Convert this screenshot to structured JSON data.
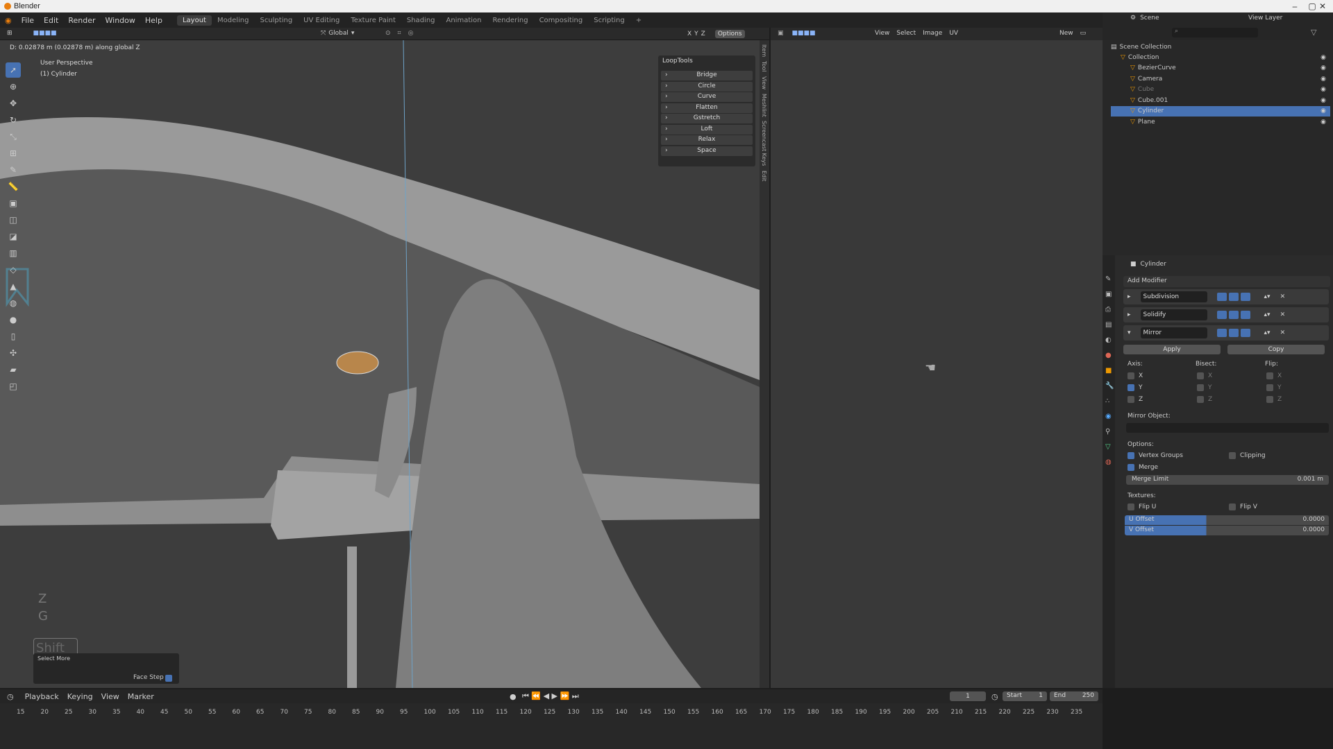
{
  "window": {
    "title": "Blender"
  },
  "menus": [
    "File",
    "Edit",
    "Render",
    "Window",
    "Help"
  ],
  "workspaces": [
    "Layout",
    "Modeling",
    "Sculpting",
    "UV Editing",
    "Texture Paint",
    "Shading",
    "Animation",
    "Rendering",
    "Compositing",
    "Scripting",
    "+"
  ],
  "scene": {
    "label": "Scene",
    "view_layer": "View Layer"
  },
  "viewport": {
    "orientation": "Global",
    "options": "Options",
    "axes": [
      "X",
      "Y",
      "Z"
    ],
    "status": "D: 0.02878 m (0.02878 m) along global Z",
    "perspective": "User Perspective",
    "object": "(1) Cylinder",
    "key_overlay": [
      "Z",
      "G",
      "Shift"
    ],
    "op_panel": {
      "title": "Select More",
      "face_step": "Face Step",
      "face_step_on": true
    }
  },
  "looptools": {
    "title": "LoopTools",
    "items": [
      "Bridge",
      "Circle",
      "Curve",
      "Flatten",
      "Gstretch",
      "Loft",
      "Relax",
      "Space"
    ]
  },
  "side_tabs": [
    "Item",
    "Tool",
    "View",
    "Meshlint",
    "Screencast Keys",
    "Edit"
  ],
  "image_editor": {
    "menus": [
      "View",
      "Select",
      "Image",
      "UV"
    ],
    "new": "New"
  },
  "outliner": {
    "root": "Scene Collection",
    "items": [
      {
        "name": "Collection",
        "depth": 1
      },
      {
        "name": "BezierCurve",
        "depth": 2
      },
      {
        "name": "Camera",
        "depth": 2
      },
      {
        "name": "Cube",
        "depth": 2,
        "dim": true
      },
      {
        "name": "Cube.001",
        "depth": 2
      },
      {
        "name": "Cylinder",
        "depth": 2,
        "selected": true
      },
      {
        "name": "Plane",
        "depth": 2
      }
    ]
  },
  "properties": {
    "object": "Cylinder",
    "add_modifier": "Add Modifier",
    "modifiers": [
      "Subdivision",
      "Solidify",
      "Mirror"
    ],
    "apply": "Apply",
    "copy": "Copy",
    "axis_label": "Axis:",
    "bisect_label": "Bisect:",
    "flip_label": "Flip:",
    "axes": [
      "X",
      "Y",
      "Z"
    ],
    "axis_on": [
      false,
      true,
      false
    ],
    "mirror_object": "Mirror Object:",
    "options_label": "Options:",
    "vertex_groups": "Vertex Groups",
    "clipping": "Clipping",
    "merge": "Merge",
    "merge_limit_label": "Merge Limit",
    "merge_limit": "0.001 m",
    "textures_label": "Textures:",
    "flip_u": "Flip U",
    "flip_v": "Flip V",
    "u_offset_label": "U Offset",
    "u_offset": "0.0000",
    "v_offset_label": "V Offset",
    "v_offset": "0.0000"
  },
  "timeline": {
    "menus": [
      "Playback",
      "Keying",
      "View",
      "Marker"
    ],
    "frame": "1",
    "start_label": "Start",
    "start": "1",
    "end_label": "End",
    "end": "250",
    "ticks": [
      "15",
      "20",
      "25",
      "30",
      "35",
      "40",
      "45",
      "50",
      "55",
      "60",
      "65",
      "70",
      "75",
      "80",
      "85",
      "90",
      "95",
      "100",
      "105",
      "110",
      "115",
      "120",
      "125",
      "130",
      "135",
      "140",
      "145",
      "150",
      "155",
      "160",
      "165",
      "170",
      "175",
      "180",
      "185",
      "190",
      "195",
      "200",
      "205",
      "210",
      "215",
      "220",
      "225",
      "230",
      "235"
    ]
  }
}
